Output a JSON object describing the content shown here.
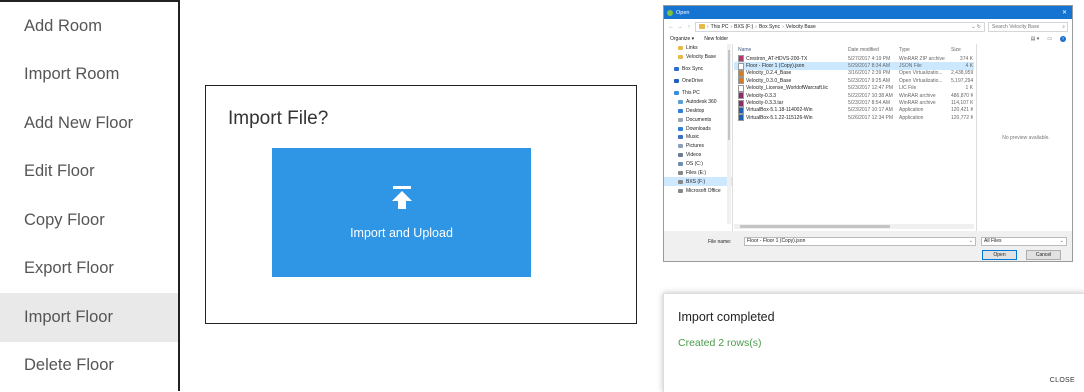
{
  "menu": {
    "items": [
      {
        "label": "Add Room",
        "active": false
      },
      {
        "label": "Import Room",
        "active": false
      },
      {
        "label": "Add New Floor",
        "active": false
      },
      {
        "label": "Edit Floor",
        "active": false
      },
      {
        "label": "Copy Floor",
        "active": false
      },
      {
        "label": "Export Floor",
        "active": false
      },
      {
        "label": "Import Floor",
        "active": true
      },
      {
        "label": "Delete Floor",
        "active": false
      }
    ]
  },
  "import_panel": {
    "title": "Import File?",
    "button_label": "Import and Upload",
    "button_color": "#2f95e5"
  },
  "open_dialog": {
    "title": "Open",
    "breadcrumb": [
      "This PC",
      "BXS (F:)",
      "Box Sync",
      "Velocity Base"
    ],
    "search_placeholder": "Search Velocity Base",
    "organize_label": "Organize ▾",
    "new_folder_label": "New folder",
    "nav_items": [
      {
        "label": "Links",
        "icon": "folder-icon"
      },
      {
        "label": "Velocity Base",
        "icon": "folder-icon"
      },
      {
        "label": "Box Sync",
        "icon": "box-icon"
      },
      {
        "label": "OneDrive",
        "icon": "cloud-icon"
      },
      {
        "label": "This PC",
        "icon": "pc-icon"
      },
      {
        "label": "Autodesk 360",
        "icon": "cloud-icon"
      },
      {
        "label": "Desktop",
        "icon": "desktop-icon"
      },
      {
        "label": "Documents",
        "icon": "documents-icon"
      },
      {
        "label": "Downloads",
        "icon": "downloads-icon"
      },
      {
        "label": "Music",
        "icon": "music-icon"
      },
      {
        "label": "Pictures",
        "icon": "pictures-icon"
      },
      {
        "label": "Videos",
        "icon": "videos-icon"
      },
      {
        "label": "OS (C:)",
        "icon": "drive-icon"
      },
      {
        "label": "Files (E:)",
        "icon": "drive-icon"
      },
      {
        "label": "BXS (F:)",
        "icon": "drive-icon"
      },
      {
        "label": "Microsoft Office",
        "icon": "drive-icon"
      }
    ],
    "columns": [
      "Name",
      "Date modified",
      "Type",
      "Size"
    ],
    "files": [
      {
        "name": "Crestron_AT-HDVS-200-TX",
        "date": "5/27/2017 4:19 PM",
        "type": "WinRAR ZIP archive",
        "size": "374 K",
        "icon_color": "#b03a6a",
        "selected": false
      },
      {
        "name": "Floor - Floor 1 (Copy).json",
        "date": "5/29/2017 8:34 AM",
        "type": "JSON File",
        "size": "4 K",
        "icon_color": "#ffffff",
        "selected": true
      },
      {
        "name": "Velocity_0.2.4_Base",
        "date": "3/16/2017 2:39 PM",
        "type": "Open Virtualizatio...",
        "size": "2,438,959 K",
        "icon_color": "#d27b29",
        "selected": false
      },
      {
        "name": "Velocity_0.3.0_Base",
        "date": "5/23/2017 9:25 AM",
        "type": "Open Virtualizatio...",
        "size": "5,197,294 K",
        "icon_color": "#d27b29",
        "selected": false
      },
      {
        "name": "Velocity_License_WorldofWarcraft.lic",
        "date": "5/23/2017 12:47 PM",
        "type": "LIC File",
        "size": "1 K",
        "icon_color": "#ffffff",
        "selected": false
      },
      {
        "name": "Velocity-0.3.3",
        "date": "5/22/2017 10:38 AM",
        "type": "WinRAR archive",
        "size": "486,870 K",
        "icon_color": "#8b2d6b",
        "selected": false
      },
      {
        "name": "Velocity-0.3.3.tar",
        "date": "5/23/2017 8:54 AM",
        "type": "WinRAR archive",
        "size": "114,107 K",
        "icon_color": "#8b2d6b",
        "selected": false
      },
      {
        "name": "VirtualBox-5.1.18-114002-Win",
        "date": "5/23/2017 10:17 AM",
        "type": "Application",
        "size": "120,421 K",
        "icon_color": "#1d5fb4",
        "selected": false
      },
      {
        "name": "VirtualBox-5.1.22-115126-Win",
        "date": "5/26/2017 12:34 PM",
        "type": "Application",
        "size": "120,772 K",
        "icon_color": "#1d5fb4",
        "selected": false
      }
    ],
    "preview_text": "No preview available.",
    "file_name_label": "File name:",
    "file_name_value": "Floor - Floor 1 (Copy).json",
    "file_type_value": "All Files",
    "open_button": "Open",
    "cancel_button": "Cancel"
  },
  "notification": {
    "title": "Import completed",
    "message": "Created 2 rows(s)",
    "close_label": "CLOSE",
    "message_color": "#4b9a4b"
  }
}
